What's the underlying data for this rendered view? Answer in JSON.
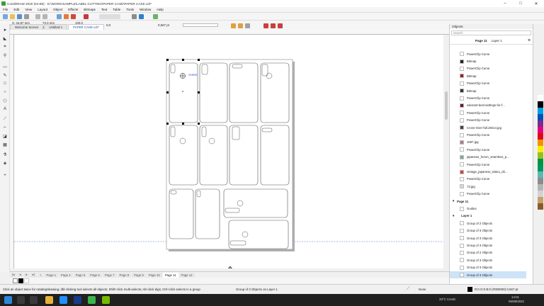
{
  "window": {
    "title": "CorelDRAW 2020 (64-Bit) - D:\\WORK\\SAMPLE\\LABEL CUTTING\\PAPER CASE\\PAPER CASE.cdr*"
  },
  "menu": [
    "File",
    "Edit",
    "View",
    "Layout",
    "Object",
    "Effects",
    "Bitmaps",
    "Text",
    "Table",
    "Tools",
    "Window",
    "Help"
  ],
  "property_bar": {
    "x": "X: 44,87 mm",
    "y": "Y: 196,725 mm",
    "w": "72,0 mm",
    "h": "153,0 mm",
    "sx": "100,0",
    "sy": "100,0",
    "pct": "%",
    "angle": "0,0",
    "outline": "0,567 pt"
  },
  "doc_tabs": [
    "Welcome Screen",
    "Untitled-1",
    "PAPER CASE.cdr*"
  ],
  "canvas": {
    "center_label": "center"
  },
  "page_tabs": [
    "Page 1",
    "Page 4",
    "Page 5",
    "Page 6",
    "Page 7",
    "Page 8",
    "Page 9",
    "Page 10",
    "Page 11",
    "Page 12"
  ],
  "active_page_tab": "Page 11",
  "docker": {
    "title": "Objects",
    "search_placeholder": "Search",
    "page_label": "Page 11",
    "layer_label": "Layer 1",
    "items": [
      "PowerClip Curve",
      "Bitmap",
      "PowerClip Curve",
      "Bitmap",
      "PowerClip Curve",
      "Bitmap",
      "PowerClip Curve",
      "valorant-best-settings-for-f...",
      "PowerClip Curve",
      "PowerClip Curve",
      "Cross-Over-full.28414.jpg",
      "PowerClip Curve",
      "1697.jpg",
      "PowerClip Curve",
      "japanese_heron_seamless_p...",
      "PowerClip Curve",
      "vintage_japanese_tattoo_dri...",
      "PowerClip Curve",
      "73.jpg",
      "PowerClip Curve"
    ],
    "tree": [
      "Page 11",
      "Guides",
      "Layer 1",
      "Group of 2 Objects",
      "Group of 3 Objects",
      "Group of 3 Objects",
      "Group of 3 Objects",
      "Group of 2 Objects",
      "Group of 3 Objects",
      "Group of 3 Objects",
      "Group of 3 Objects"
    ]
  },
  "status": {
    "hint": "Click an object twice for rotating/skewing; dbl-clicking tool selects all objects; Shift+click multi-selects; Alt+click digs; Ctrl+click selects in a group",
    "selection": "Group of 3 Objects on Layer 1",
    "fill": "None",
    "color": "R:0 G:0 B:0 (#000000)  0,567 pt"
  },
  "taskbar": {
    "weather": "33°C  Cerah",
    "time": "14:01",
    "date": "05/08/2022"
  },
  "palette": [
    "#ffffff",
    "#000000",
    "#00a0e3",
    "#0050b4",
    "#7d2a8c",
    "#e6007e",
    "#e30613",
    "#f39200",
    "#ffed00",
    "#95c11f",
    "#009640",
    "#00975f",
    "#5cb8b2",
    "#8c8c8c",
    "#b4b4b4",
    "#d2d2d2",
    "#c8a06e",
    "#8b5a2b"
  ]
}
